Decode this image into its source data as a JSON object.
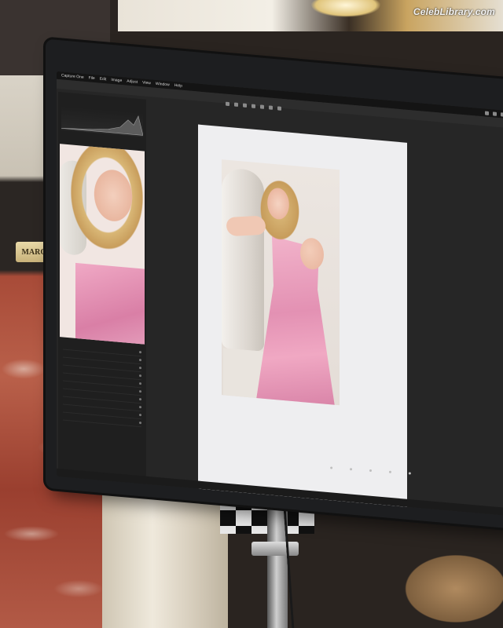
{
  "watermark": "CelebLibrary.com",
  "plaque": {
    "text": "MARC"
  },
  "app": {
    "menu_items": [
      "Capture One",
      "File",
      "Edit",
      "Image",
      "Adjust",
      "View",
      "Window",
      "Help"
    ],
    "file_title": "",
    "status_text": ""
  },
  "panel": {
    "rows": [
      "",
      "",
      "",
      "",
      "",
      "",
      "",
      "",
      "",
      ""
    ]
  },
  "colors": {
    "dress": "#e391b3",
    "screen_bg": "#262626",
    "viewer_bg": "#eeeef0",
    "bezel": "#1d1e20"
  }
}
